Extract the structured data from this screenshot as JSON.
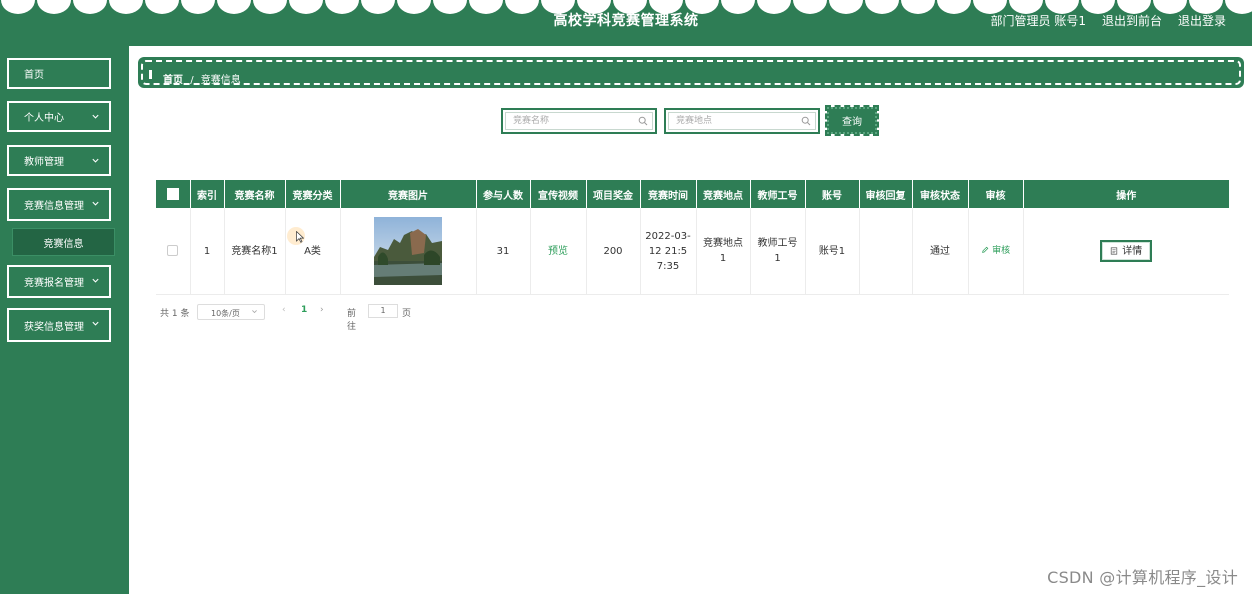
{
  "header": {
    "title": "高校学科竞赛管理系统",
    "user": "部门管理员 账号1",
    "to_front": "退出到前台",
    "logout": "退出登录"
  },
  "sidebar": {
    "items": [
      {
        "label": "首页"
      },
      {
        "label": "个人中心"
      },
      {
        "label": "教师管理"
      },
      {
        "label": "竞赛信息管理"
      },
      {
        "label": "竞赛报名管理"
      },
      {
        "label": "获奖信息管理"
      }
    ],
    "sub_item": "竞赛信息"
  },
  "breadcrumb": {
    "home": "首页",
    "sep": "/",
    "current": "竞赛信息"
  },
  "search": {
    "name_placeholder": "竞赛名称",
    "place_placeholder": "竞赛地点",
    "query_label": "查询"
  },
  "table": {
    "headers": [
      "索引",
      "竞赛名称",
      "竞赛分类",
      "竞赛图片",
      "参与人数",
      "宣传视频",
      "项目奖金",
      "竞赛时间",
      "竞赛地点",
      "教师工号",
      "账号",
      "审核回复",
      "审核状态",
      "审核",
      "操作"
    ],
    "row": {
      "index": "1",
      "name": "竞赛名称1",
      "category": "A类",
      "participants": "31",
      "video": "预览",
      "bonus": "200",
      "time": "2022-03-12 21:57:35",
      "place": "竞赛地点1",
      "teacher_no": "教师工号1",
      "account": "账号1",
      "reply": "",
      "status": "通过",
      "audit": "审核",
      "detail": "详情"
    }
  },
  "pager": {
    "total": "共 1 条",
    "size": "10条/页",
    "current": "1",
    "goto": "前往",
    "goto_value": "1",
    "unit": "页"
  },
  "watermark": "CSDN @计算机程序_设计",
  "colors": {
    "primary": "#2e7d55",
    "link": "#2e9e5b"
  }
}
